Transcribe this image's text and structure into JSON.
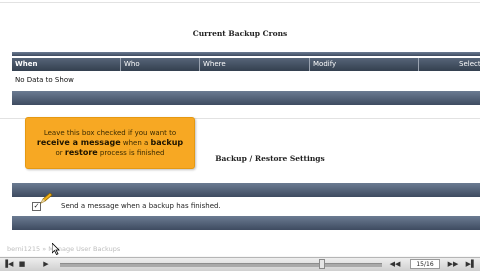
{
  "backup_crons": {
    "title": "Current Backup Crons",
    "columns": [
      "When",
      "Who",
      "Where",
      "Modify",
      "Select"
    ],
    "empty_message": "No Data to Show"
  },
  "tooltip": {
    "line1": "Leave this box checked if you want to",
    "line2_pre": "receive a message",
    "line2_mid": " when a ",
    "line2_bold": "backup",
    "line3_pre": "or ",
    "line3_bold": "restore",
    "line3_post": " process is finished"
  },
  "settings": {
    "title": "Backup / Restore Settings",
    "checkbox_label": "Send a message when a backup has finished.",
    "checked": true
  },
  "footer": {
    "faded_text": "berni1215 » Manage User Backups"
  },
  "player": {
    "counter": "15/16",
    "progress": 0.93,
    "colors": {
      "tooltip": "#f7a823",
      "header": "#3e4b60"
    }
  }
}
